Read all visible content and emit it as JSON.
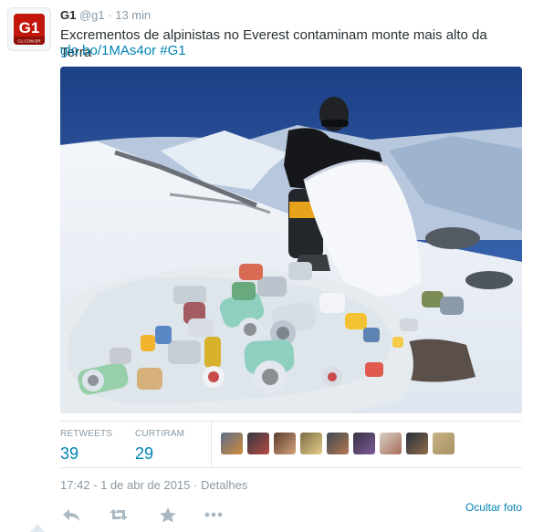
{
  "tweet": {
    "author_name": "G1",
    "handle": "@g1",
    "separator": "·",
    "relative_time": "13 min",
    "text": "Excrementos de alpinistas no Everest contaminam monte mais alto da Terra",
    "link": "glo.bo/1MAs4or",
    "hashtag": "#G1",
    "avatar_text": "G1",
    "avatar_subtext": "G1.COM.BR",
    "brand_color": "#c4170c",
    "link_color": "#0084b4"
  },
  "stats": {
    "retweets_label": "RETWEETS",
    "retweets_count": "39",
    "likes_label": "CURTIRAM",
    "likes_count": "29"
  },
  "timestamp": {
    "text": "17:42 - 1 de abr de 2015",
    "separator": "·",
    "details": "Detalhes"
  },
  "actions": {
    "reply_icon": "reply-icon",
    "retweet_icon": "retweet-icon",
    "favorite_icon": "star-icon",
    "more_icon": "more-icon"
  },
  "hide_photo": "Ocultar foto"
}
